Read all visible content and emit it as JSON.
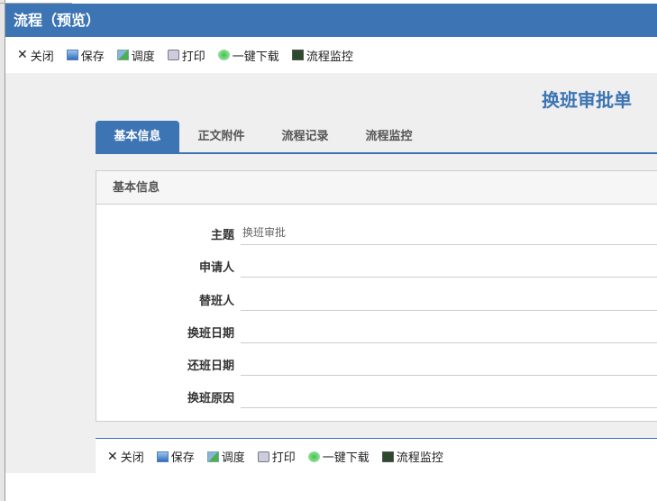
{
  "window": {
    "title": "流程（预览）"
  },
  "toolbar": [
    {
      "label": "关闭",
      "icon": "close-icon"
    },
    {
      "label": "保存",
      "icon": "save-icon"
    },
    {
      "label": "调度",
      "icon": "dispatch-icon"
    },
    {
      "label": "打印",
      "icon": "print-icon"
    },
    {
      "label": "一键下载",
      "icon": "download-icon"
    },
    {
      "label": "流程监控",
      "icon": "monitor-icon"
    }
  ],
  "doc_title": "换班审批单",
  "tabs": [
    "基本信息",
    "正文附件",
    "流程记录",
    "流程监控"
  ],
  "panel": {
    "title": "基本信息",
    "fields": [
      {
        "label": "主题",
        "value": "换班审批"
      },
      {
        "label": "申请人",
        "value": ""
      },
      {
        "label": "替班人",
        "value": ""
      },
      {
        "label": "换班日期",
        "value": ""
      },
      {
        "label": "还班日期",
        "value": ""
      },
      {
        "label": "换班原因",
        "value": ""
      }
    ]
  },
  "colors": {
    "accent": "#3c74b4",
    "background": "#efefef"
  }
}
